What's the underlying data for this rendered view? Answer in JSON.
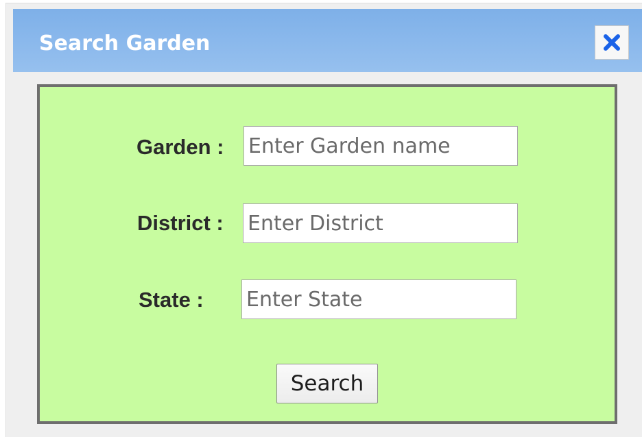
{
  "dialog": {
    "title": "Search Garden",
    "close_icon": "close-icon",
    "accent_color": "#1a62e8"
  },
  "form": {
    "garden": {
      "label": "Garden :",
      "value": "",
      "placeholder": "Enter Garden name"
    },
    "district": {
      "label": "District :",
      "value": "",
      "placeholder": "Enter District"
    },
    "state": {
      "label": "State :",
      "value": "",
      "placeholder": "Enter State"
    },
    "search_label": "Search"
  },
  "colors": {
    "titlebar": "#84b4ea",
    "panel_background": "#c8fca0",
    "panel_border": "#6e6e6e",
    "dialog_background": "#efefef"
  }
}
